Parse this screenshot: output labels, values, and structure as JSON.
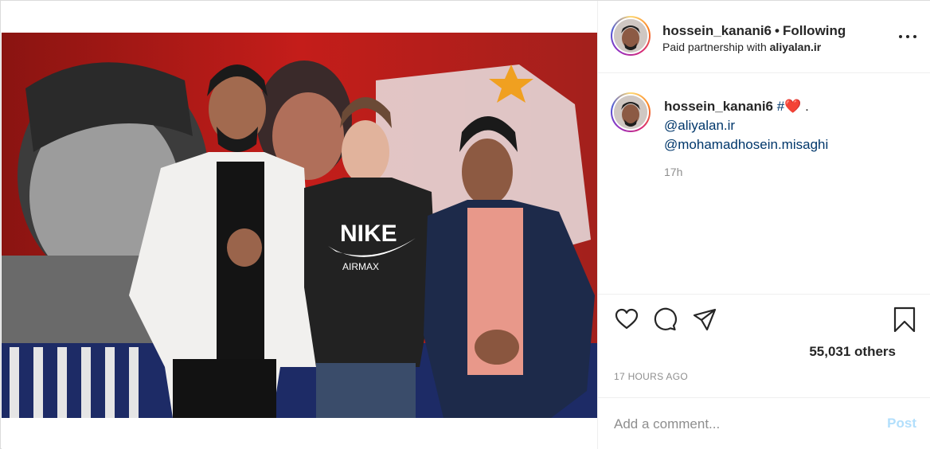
{
  "post": {
    "username": "hossein_kanani6",
    "following_label": "Following",
    "paid_partnership_prefix": "Paid partnership with",
    "partner": "aliyalan.ir",
    "caption_hash": "#",
    "caption_emoji": "❤️",
    "caption_suffix": ".",
    "mentions": [
      "@aliyalan.ir",
      "@mohamadhosein.misaghi"
    ],
    "relative_time": "17h",
    "likes": "55,031 others",
    "posted_ago": "17 HOURS AGO",
    "comment_placeholder": "Add a comment...",
    "post_button": "Post"
  },
  "photo": {
    "shirt_brand": "NIKE",
    "shirt_sub": "AIRMAX"
  },
  "icons": {
    "like": "heart-icon",
    "comment": "comment-icon",
    "share": "share-icon",
    "save": "bookmark-icon",
    "more": "more-options-icon"
  },
  "colors": {
    "link": "#00376b",
    "post_button": "#b2dffc",
    "muted": "#8e8e8e"
  }
}
